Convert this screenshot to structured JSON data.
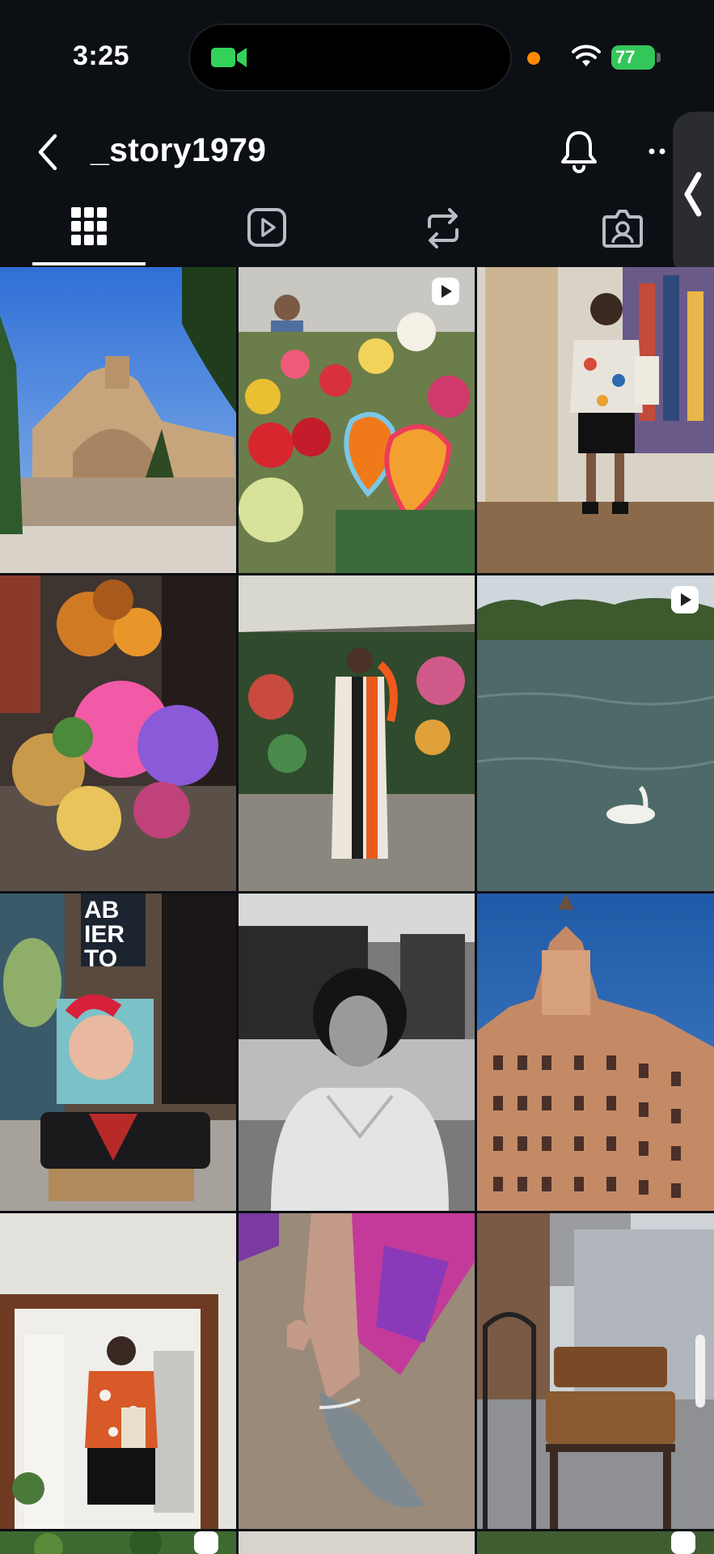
{
  "status_bar": {
    "time": "3:25",
    "battery": "77",
    "battery_color": "#33c759",
    "recording_dot_color": "#ff8a00",
    "camera_indicator_color": "#33d35b"
  },
  "header": {
    "username": "_story1979",
    "back_icon": "chevron-left-icon",
    "bell_icon": "bell-icon",
    "more_icon": "more-horizontal-icon"
  },
  "tabs": [
    {
      "name": "grid",
      "icon": "grid-icon",
      "active": true
    },
    {
      "name": "reels",
      "icon": "reels-icon",
      "active": false
    },
    {
      "name": "reposts",
      "icon": "repost-icon",
      "active": false
    },
    {
      "name": "tagged",
      "icon": "tagged-icon",
      "active": false
    }
  ],
  "grid": {
    "posts": [
      {
        "subject": "cathedral",
        "reel": false
      },
      {
        "subject": "flower-market",
        "reel": true
      },
      {
        "subject": "thrift-store-selfie",
        "reel": false
      },
      {
        "subject": "dried-flowers",
        "reel": false
      },
      {
        "subject": "striped-dress",
        "reel": false
      },
      {
        "subject": "lake-swan",
        "reel": true
      },
      {
        "subject": "dali-cushion",
        "reel": false,
        "sign_text": [
          "AB",
          "IER",
          "TO"
        ]
      },
      {
        "subject": "bw-portrait",
        "reel": false
      },
      {
        "subject": "ornate-building",
        "reel": false
      },
      {
        "subject": "mirror-selfie",
        "reel": false
      },
      {
        "subject": "pointed-shoes",
        "reel": false
      },
      {
        "subject": "vintage-suitcases",
        "reel": false
      }
    ]
  }
}
